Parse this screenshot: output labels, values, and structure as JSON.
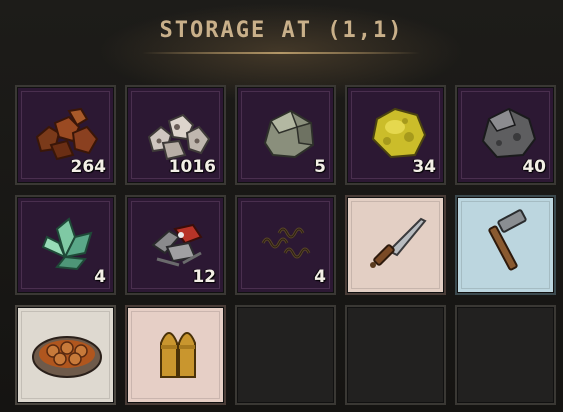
{
  "window": {
    "title": "STORAGE AT (1,1)"
  },
  "inventory": {
    "slots": [
      {
        "item": "copper-ore-icon",
        "count": "264"
      },
      {
        "item": "iron-ore-icon",
        "count": "1016"
      },
      {
        "item": "stone-icon",
        "count": "5"
      },
      {
        "item": "sulfur-ore-icon",
        "count": "34"
      },
      {
        "item": "coal-icon",
        "count": "40"
      },
      {
        "item": "crystal-icon",
        "count": "4"
      },
      {
        "item": "scrap-metal-icon",
        "count": "12"
      },
      {
        "item": "springs-icon",
        "count": "4"
      },
      {
        "item": "knife-icon",
        "count": ""
      },
      {
        "item": "hammer-icon",
        "count": ""
      },
      {
        "item": "meatball-stew-icon",
        "count": ""
      },
      {
        "item": "bullets-icon",
        "count": ""
      },
      {
        "item": "",
        "count": ""
      },
      {
        "item": "",
        "count": ""
      },
      {
        "item": "",
        "count": ""
      }
    ]
  },
  "colors": {
    "resource_slot_bg": "#2c1833",
    "empty_slot_bg": "#222120",
    "title_color": "#c9b08a",
    "knife_bg": "#e3cfc4",
    "hammer_bg": "#bcd6df"
  }
}
